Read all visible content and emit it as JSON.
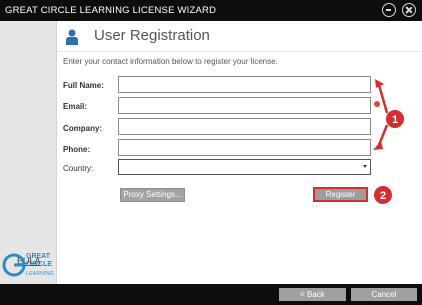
{
  "window": {
    "title": "GREAT CIRCLE LEARNING LICENSE WIZARD"
  },
  "sidebar": {
    "eula_label": "EULA",
    "logo_line1": "GREAT",
    "logo_line2": "CIRCLE",
    "logo_line3": "LEARNING"
  },
  "main": {
    "heading": "User Registration",
    "instructions": "Enter your contact information below to register your license.",
    "fields": [
      {
        "label": "Full Name:",
        "value": ""
      },
      {
        "label": "Email:",
        "value": ""
      },
      {
        "label": "Company:",
        "value": ""
      },
      {
        "label": "Phone:",
        "value": ""
      }
    ],
    "country": {
      "label": "Country:",
      "value": ""
    },
    "proxy_button": "Proxy Settings...",
    "register_button": "Register"
  },
  "annotations": {
    "marker1": "1",
    "marker2": "2"
  },
  "footer": {
    "back_button": "< Back",
    "cancel_button": "Cancel"
  },
  "colors": {
    "titlebar": "#0d0d0d",
    "annotation_red": "#d62e2e",
    "brand_blue": "#2a8ccf"
  }
}
